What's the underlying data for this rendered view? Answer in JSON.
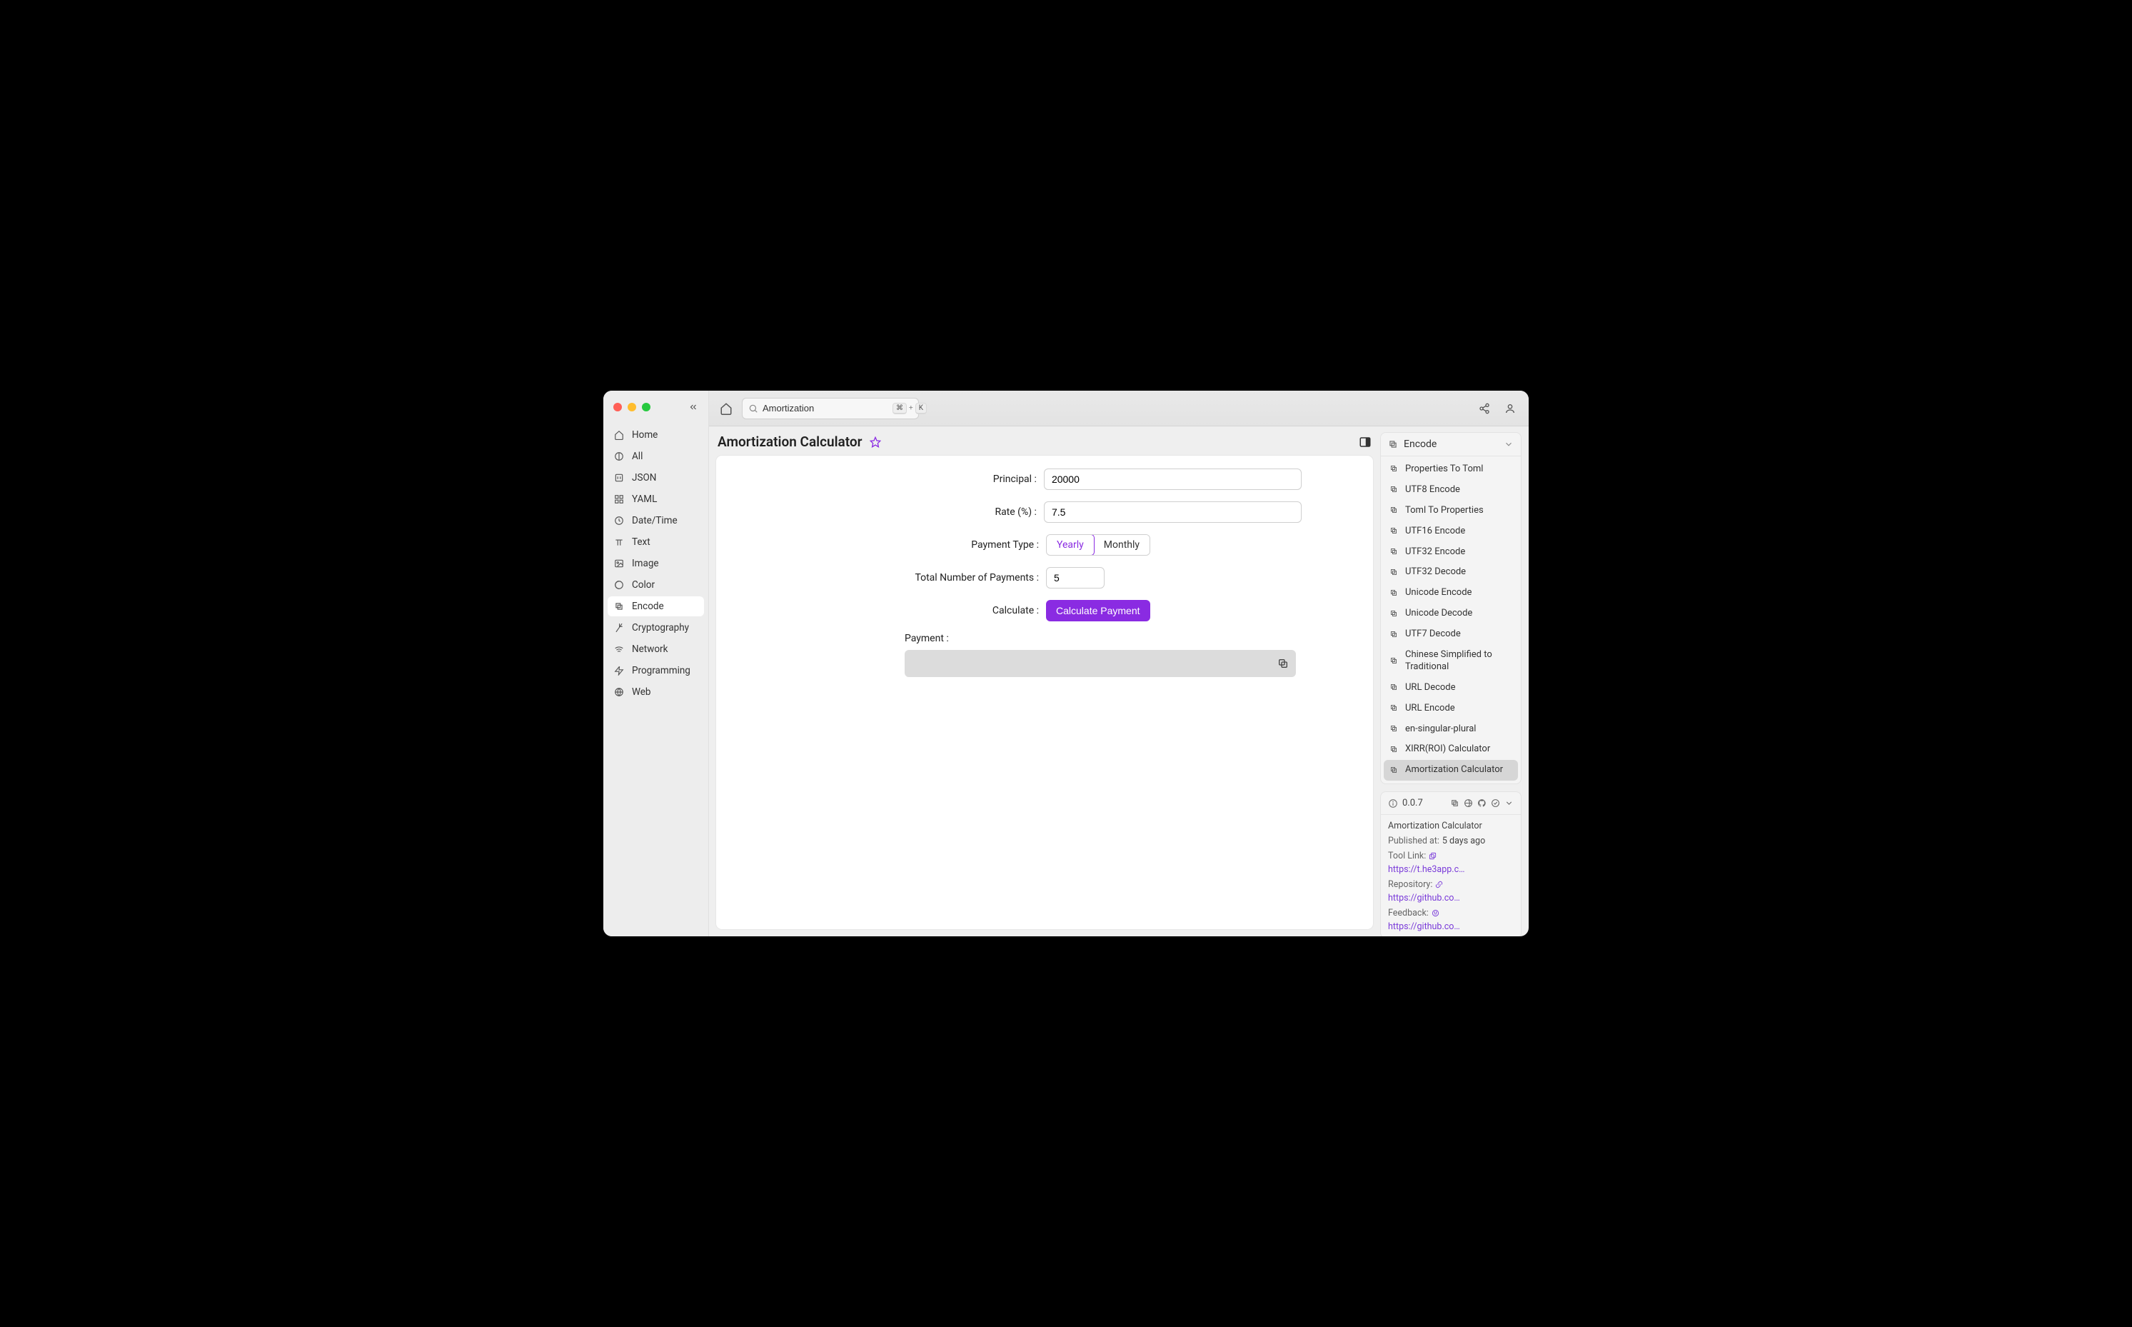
{
  "sidebar": {
    "items": [
      {
        "label": "Home"
      },
      {
        "label": "All"
      },
      {
        "label": "JSON"
      },
      {
        "label": "YAML"
      },
      {
        "label": "Date/Time"
      },
      {
        "label": "Text"
      },
      {
        "label": "Image"
      },
      {
        "label": "Color"
      },
      {
        "label": "Encode"
      },
      {
        "label": "Cryptography"
      },
      {
        "label": "Network"
      },
      {
        "label": "Programming"
      },
      {
        "label": "Web"
      }
    ]
  },
  "topbar": {
    "search_value": "Amortization",
    "kbd1": "⌘",
    "kbd_plus": "+",
    "kbd2": "K"
  },
  "page": {
    "title": "Amortization Calculator"
  },
  "form": {
    "labels": {
      "principal": "Principal",
      "rate": "Rate (%)",
      "payment_type": "Payment Type",
      "total_payments": "Total Number of Payments",
      "calculate": "Calculate",
      "payment_output": "Payment :"
    },
    "principal_value": "20000",
    "rate_value": "7.5",
    "segments": {
      "yearly": "Yearly",
      "monthly": "Monthly"
    },
    "total_payments_value": "5",
    "calculate_button": "Calculate Payment"
  },
  "rightpanel": {
    "header": "Encode",
    "items": [
      "Properties To Toml",
      "UTF8 Encode",
      "Toml To Properties",
      "UTF16 Encode",
      "UTF32 Encode",
      "UTF32 Decode",
      "Unicode Encode",
      "Unicode Decode",
      "UTF7 Decode",
      "Chinese Simplified to Traditional",
      "URL Decode",
      "URL Encode",
      "en-singular-plural",
      "XIRR(ROI) Calculator",
      "Amortization Calculator"
    ]
  },
  "info": {
    "version": "0.0.7",
    "name": "Amortization Calculator",
    "published_label": "Published at:",
    "published_value": "5 days ago",
    "tool_link_label": "Tool Link:",
    "tool_link_value": "https://t.he3app.co…",
    "repo_label": "Repository:",
    "repo_value": "https://github.com…",
    "feedback_label": "Feedback:",
    "feedback_value": "https://github.com/…"
  }
}
